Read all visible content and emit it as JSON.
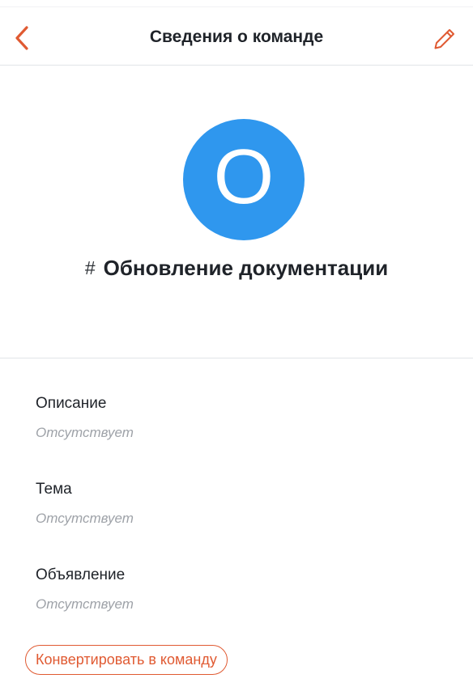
{
  "header": {
    "title": "Сведения о команде",
    "accent_color": "#e05a32"
  },
  "room": {
    "avatar_letter": "O",
    "avatar_color": "#2f97ee",
    "type_icon": "hash-icon",
    "hash_symbol": "#",
    "name": "Обновление документации"
  },
  "info": {
    "description": {
      "title": "Описание",
      "value": "Отсутствует"
    },
    "topic": {
      "title": "Тема",
      "value": "Отсутствует"
    },
    "announcement": {
      "title": "Объявление",
      "value": "Отсутствует"
    }
  },
  "actions": {
    "convert_label": "Конвертировать в команду"
  }
}
